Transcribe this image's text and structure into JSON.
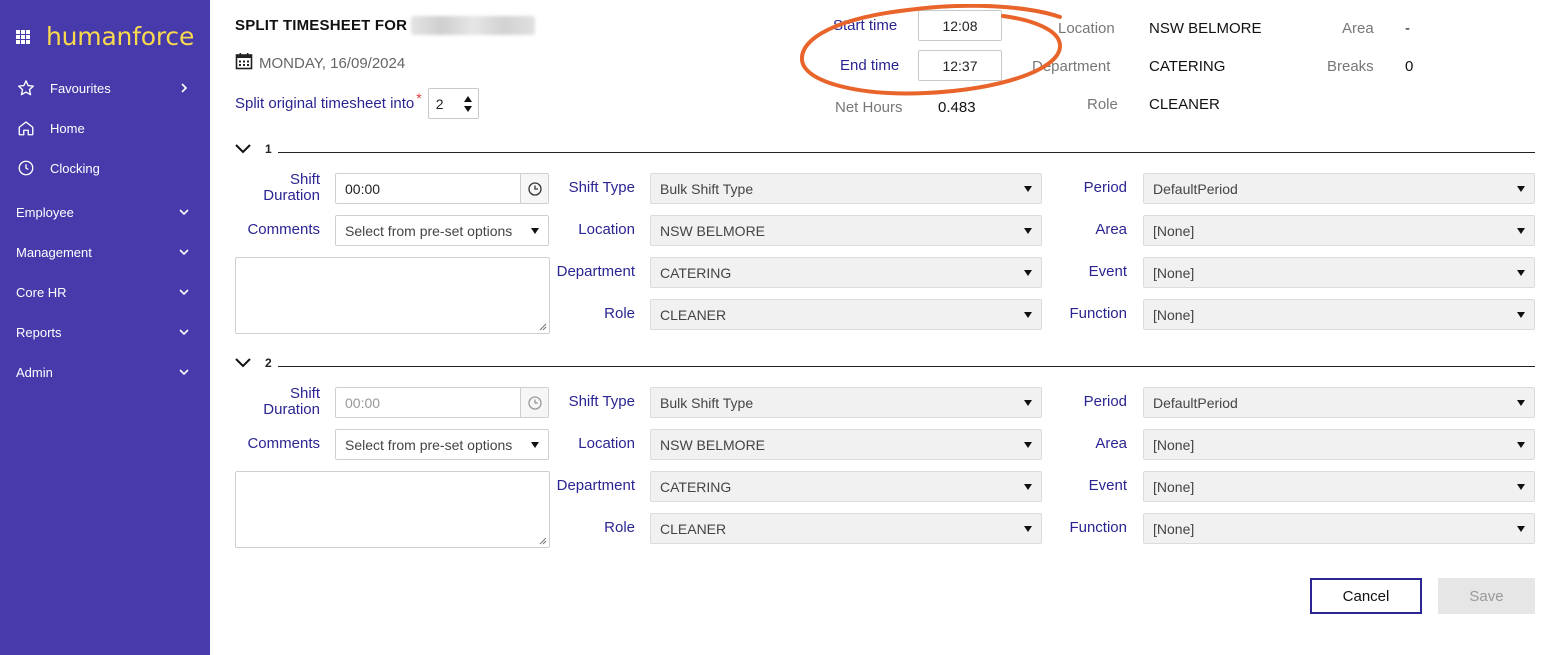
{
  "sidebar": {
    "brand": "humanforce",
    "items": [
      {
        "label": "Favourites",
        "icon": "star-icon"
      },
      {
        "label": "Home",
        "icon": "home-icon"
      },
      {
        "label": "Clocking",
        "icon": "clock-icon"
      },
      {
        "label": "Employee"
      },
      {
        "label": "Management"
      },
      {
        "label": "Core HR"
      },
      {
        "label": "Reports"
      },
      {
        "label": "Admin"
      }
    ]
  },
  "header": {
    "title": "SPLIT TIMESHEET FOR",
    "date": "MONDAY, 16/09/2024",
    "split_label": "Split original timesheet into",
    "required_mark": "*",
    "split_count": "2"
  },
  "summary": {
    "start_time_label": "Start time",
    "start_time": "12:08",
    "end_time_label": "End time",
    "end_time": "12:37",
    "net_hours_label": "Net Hours",
    "net_hours": "0.483",
    "location_label": "Location",
    "location": "NSW BELMORE",
    "department_label": "Department",
    "department": "CATERING",
    "role_label": "Role",
    "role": "CLEANER",
    "area_label": "Area",
    "area": "-",
    "breaks_label": "Breaks",
    "breaks": "0"
  },
  "labels": {
    "shift_duration_1": "Shift",
    "shift_duration_2": "Duration",
    "comments": "Comments",
    "shift_type": "Shift Type",
    "location": "Location",
    "department": "Department",
    "role": "Role",
    "period": "Period",
    "area": "Area",
    "event": "Event",
    "function": "Function"
  },
  "sections": [
    {
      "number": "1",
      "shift_duration": "00:00",
      "comments_placeholder": "Select from pre-set options",
      "shift_type": "Bulk Shift Type",
      "location": "NSW BELMORE",
      "department": "CATERING",
      "role": "CLEANER",
      "period": "DefaultPeriod",
      "area": "[None]",
      "event": "[None]",
      "function": "[None]"
    },
    {
      "number": "2",
      "shift_duration": "00:00",
      "comments_placeholder": "Select from pre-set options",
      "shift_type": "Bulk Shift Type",
      "location": "NSW BELMORE",
      "department": "CATERING",
      "role": "CLEANER",
      "period": "DefaultPeriod",
      "area": "[None]",
      "event": "[None]",
      "function": "[None]"
    }
  ],
  "actions": {
    "cancel": "Cancel",
    "save": "Save"
  },
  "colors": {
    "sidebar": "#473bab",
    "brand": "#f9d94d",
    "label": "#2a2592",
    "annotation": "#e8642a"
  }
}
